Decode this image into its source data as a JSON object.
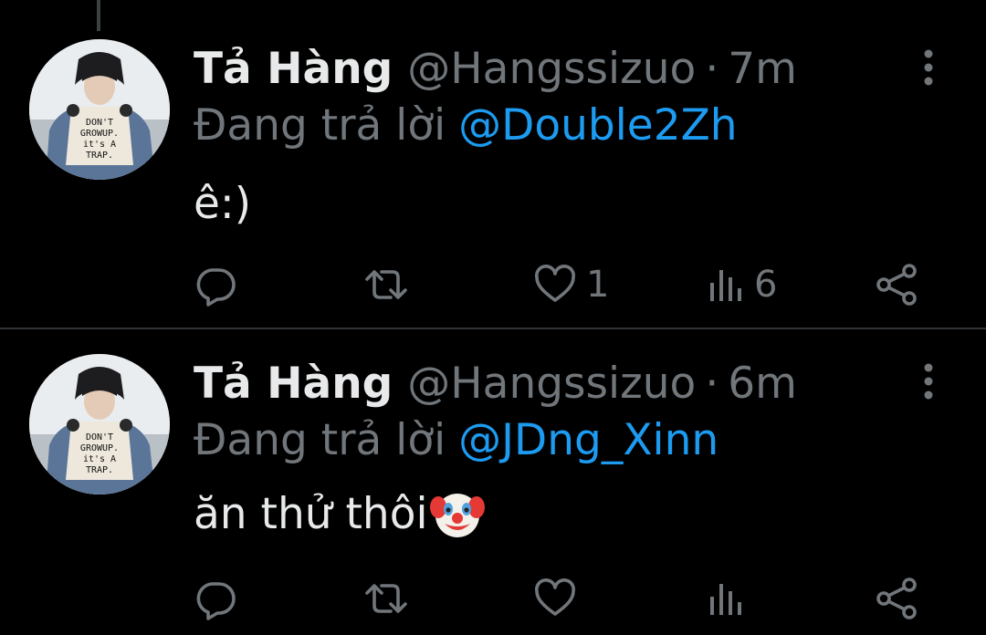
{
  "colors": {
    "background": "#000000",
    "primary_text": "#e7e9ea",
    "secondary_text": "#71767b",
    "link_blue": "#1d9bf0",
    "divider": "#2f3336"
  },
  "tweets": [
    {
      "author_name": "Tả Hàng",
      "handle": "@Hangssizuo",
      "separator": "·",
      "time": "7m",
      "reply_prefix": "Đang trả lời",
      "reply_to": "@Double2Zh",
      "text": "ê:)",
      "emoji_icon": "",
      "likes": "1",
      "views": "6",
      "avatar_text": [
        "DON'T",
        "GROWUP.",
        "it's A",
        "TRAP."
      ]
    },
    {
      "author_name": "Tả Hàng",
      "handle": "@Hangssizuo",
      "separator": "·",
      "time": "6m",
      "reply_prefix": "Đang trả lời",
      "reply_to": "@JDng_Xinn",
      "text": "ăn thử thôi",
      "emoji_icon": "clown-face-icon",
      "likes": "",
      "views": "",
      "avatar_text": [
        "DON'T",
        "GROWUP.",
        "it's A",
        "TRAP."
      ]
    }
  ],
  "icons": {
    "reply": "reply-icon",
    "retweet": "retweet-icon",
    "like": "heart-icon",
    "views": "views-icon",
    "share": "share-icon",
    "more": "more-options-icon"
  }
}
